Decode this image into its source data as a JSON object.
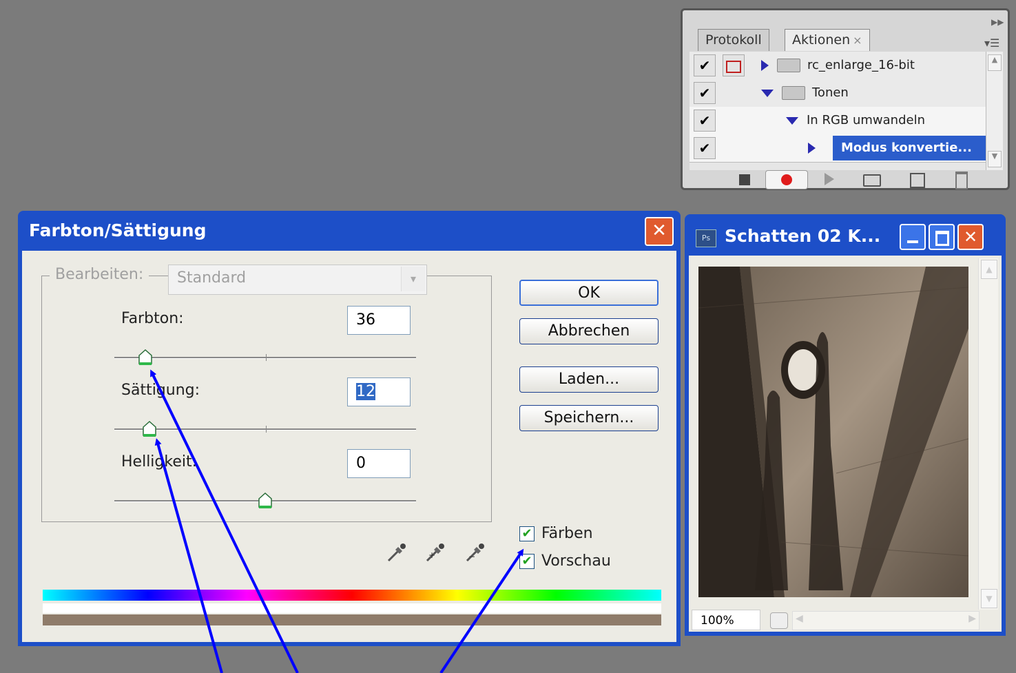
{
  "actions_panel": {
    "tabs": [
      {
        "label": "Protokoll"
      },
      {
        "label": "Aktionen",
        "close": "×"
      }
    ],
    "rows": [
      {
        "check": "✔",
        "label": "rc_enlarge_16-bit",
        "selected": false
      },
      {
        "check": "✔",
        "label": "Tonen",
        "selected": false
      },
      {
        "check": "✔",
        "label": "In RGB umwandeln",
        "selected": false
      },
      {
        "check": "✔",
        "label": "Modus konvertie...",
        "selected": true
      }
    ]
  },
  "dialog": {
    "title": "Farbton/Sättigung",
    "close": "✕",
    "edit_label": "Bearbeiten:",
    "edit_value": "Standard",
    "hue_label": "Farbton:",
    "hue_value": "36",
    "saturation_label": "Sättigung:",
    "saturation_value": "12",
    "lightness_label": "Helligkeit:",
    "lightness_value": "0",
    "ok_label": "OK",
    "cancel_label": "Abbrechen",
    "load_label": "Laden...",
    "save_label": "Speichern...",
    "colorize_label": "Färben",
    "preview_label": "Vorschau",
    "colorize_checked": true,
    "preview_checked": true,
    "sepia_color": "#8f7c6a"
  },
  "image_window": {
    "title": "Schatten 02 K...",
    "ps_badge": "Ps",
    "zoom": "100%"
  }
}
